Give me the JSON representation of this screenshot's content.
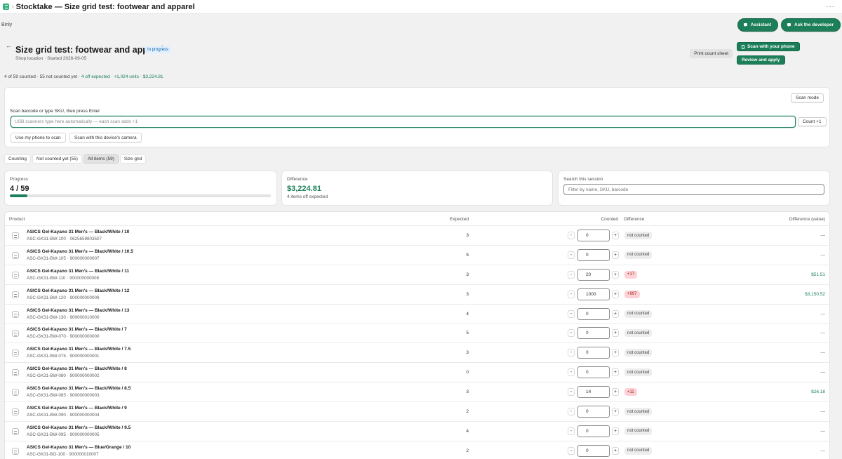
{
  "topbar": {
    "title": "Stocktake — Size grid test: footwear and apparel",
    "more": "···"
  },
  "appbar": {
    "name": "Binly",
    "assistant_label": "Assistant",
    "ask_dev_label": "Ask the developer"
  },
  "page": {
    "title": "Size grid test: footwear and apparel",
    "status": "In progress",
    "meta": "Shop location · Started 2026-09-05",
    "print_label": "Print count sheet",
    "scan_phone_label": "Scan with your phone",
    "review_label": "Review and apply"
  },
  "summary": {
    "counted": "4 of 59 counted · 55 not counted yet ·",
    "off": "4 off expected · +1,024 units · $3,224.81"
  },
  "scan": {
    "mode_label": "Scan mode",
    "label": "Scan barcode or type SKU, then press Enter",
    "placeholder": "USB scanners type here automatically — each scan adds +1",
    "count_label": "Count +1",
    "use_phone_label": "Use my phone to scan",
    "camera_label": "Scan with this device's camera"
  },
  "tabs": [
    {
      "label": "Counting"
    },
    {
      "label": "Not counted yet (55)"
    },
    {
      "label": "All items (59)"
    },
    {
      "label": "Size grid"
    }
  ],
  "stats": {
    "progress_label": "Progress",
    "progress_value": "4 / 59",
    "progress_fraction": 0.068,
    "difference_label": "Difference",
    "difference_value": "$3,224.81",
    "difference_sub": "4 items off expected",
    "search_label": "Search this session",
    "search_placeholder": "Filter by name, SKU, barcode"
  },
  "table": {
    "headers": {
      "product": "Product",
      "expected": "Expected",
      "counted": "Counted",
      "difference": "Difference",
      "difference_value": "Difference (value)"
    },
    "minus": "-",
    "plus": "+",
    "rows": [
      {
        "name": "ASICS Gel-Kayano 31 Men's — Black/White / 10",
        "sku": "ASC-GK31-BW-100 · 0625659803507",
        "expected": "3",
        "counted": "0",
        "diff": "not counted",
        "diff_type": "neutral",
        "value": "—"
      },
      {
        "name": "ASICS Gel-Kayano 31 Men's — Black/White / 10.5",
        "sku": "ASC-GK31-BW-105 · 900000000007",
        "expected": "5",
        "counted": "0",
        "diff": "not counted",
        "diff_type": "neutral",
        "value": "—"
      },
      {
        "name": "ASICS Gel-Kayano 31 Men's — Black/White / 11",
        "sku": "ASC-GK31-BW-110 · 900000000008",
        "expected": "3",
        "counted": "20",
        "diff": "+17",
        "diff_type": "over",
        "value": "$51.51"
      },
      {
        "name": "ASICS Gel-Kayano 31 Men's — Black/White / 12",
        "sku": "ASC-GK31-BW-120 · 900000000009",
        "expected": "3",
        "counted": "1000",
        "diff": "+997",
        "diff_type": "over",
        "value": "$3,150.52"
      },
      {
        "name": "ASICS Gel-Kayano 31 Men's — Black/White / 13",
        "sku": "ASC-GK31-BW-130 · 900000010000",
        "expected": "4",
        "counted": "0",
        "diff": "not counted",
        "diff_type": "neutral",
        "value": "—"
      },
      {
        "name": "ASICS Gel-Kayano 31 Men's — Black/White / 7",
        "sku": "ASC-GK31-BW-070 · 900000000000",
        "expected": "5",
        "counted": "0",
        "diff": "not counted",
        "diff_type": "neutral",
        "value": "—"
      },
      {
        "name": "ASICS Gel-Kayano 31 Men's — Black/White / 7.5",
        "sku": "ASC-GK31-BW-075 · 900000000001",
        "expected": "3",
        "counted": "0",
        "diff": "not counted",
        "diff_type": "neutral",
        "value": "—"
      },
      {
        "name": "ASICS Gel-Kayano 31 Men's — Black/White / 8",
        "sku": "ASC-GK31-BW-080 · 900000000002",
        "expected": "0",
        "counted": "0",
        "diff": "not counted",
        "diff_type": "neutral",
        "value": "—"
      },
      {
        "name": "ASICS Gel-Kayano 31 Men's — Black/White / 8.5",
        "sku": "ASC-GK31-BW-085 · 900000000003",
        "expected": "3",
        "counted": "14",
        "diff": "+11",
        "diff_type": "over",
        "value": "$26.18"
      },
      {
        "name": "ASICS Gel-Kayano 31 Men's — Black/White / 9",
        "sku": "ASC-GK31-BW-090 · 900000000004",
        "expected": "2",
        "counted": "0",
        "diff": "not counted",
        "diff_type": "neutral",
        "value": "—"
      },
      {
        "name": "ASICS Gel-Kayano 31 Men's — Black/White / 9.5",
        "sku": "ASC-GK31-BW-095 · 900000000005",
        "expected": "4",
        "counted": "0",
        "diff": "not counted",
        "diff_type": "neutral",
        "value": "—"
      },
      {
        "name": "ASICS Gel-Kayano 31 Men's — Blue/Orange / 10",
        "sku": "ASC-GK31-BO-100 · 900000010007",
        "expected": "2",
        "counted": "0",
        "diff": "not counted",
        "diff_type": "neutral",
        "value": "—"
      }
    ]
  },
  "colors": {
    "accent": "#1c7f5a",
    "badge_over": "#fed1d7",
    "badge_neutral": "#ededed",
    "status_badge": "#e0f0ff"
  }
}
